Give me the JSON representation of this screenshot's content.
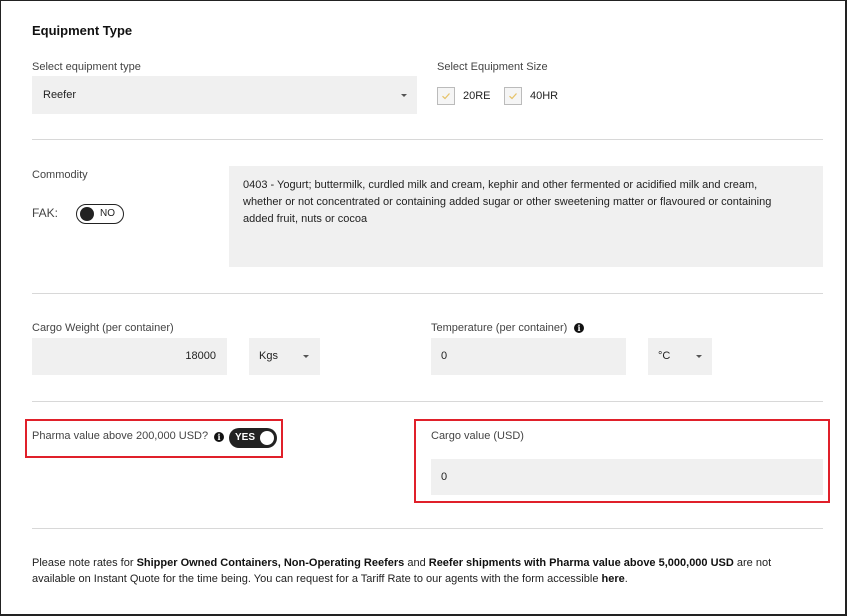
{
  "section_title": "Equipment Type",
  "equipment": {
    "type_label": "Select equipment type",
    "type_value": "Reefer",
    "size_label": "Select Equipment Size",
    "sizes": [
      {
        "label": "20RE",
        "checked": true
      },
      {
        "label": "40HR",
        "checked": true
      }
    ]
  },
  "commodity": {
    "label": "Commodity",
    "fak_label": "FAK:",
    "fak_toggle": "NO",
    "description": "0403 - Yogurt; buttermilk, curdled milk and cream, kephir and other fermented or acidified milk and cream, whether or not concentrated or containing added sugar or other sweetening matter or flavoured or containing added fruit, nuts or cocoa"
  },
  "weight": {
    "label": "Cargo Weight (per container)",
    "value": "18000",
    "unit": "Kgs"
  },
  "temperature": {
    "label": "Temperature (per container)",
    "value": "0",
    "unit": "°C"
  },
  "pharma": {
    "label": "Pharma value above 200,000 USD?",
    "toggle": "YES"
  },
  "cargo_value": {
    "label": "Cargo value (USD)",
    "value": "0"
  },
  "note": {
    "p1": "Please note rates for ",
    "b1": "Shipper Owned Containers, Non-Operating Reefers",
    "p2": " and ",
    "b2": "Reefer shipments with Pharma value above 5,000,000 USD",
    "p3": " are not available on Instant Quote for the time being. You can request for a Tariff Rate to our agents with the form accessible ",
    "link": "here",
    "p4": "."
  },
  "colors": {
    "highlight": "#e0202a",
    "check": "#e6c36a",
    "field_bg": "#f0f0f0"
  },
  "icons": [
    "chevron-down-icon",
    "check-icon",
    "info-icon"
  ]
}
